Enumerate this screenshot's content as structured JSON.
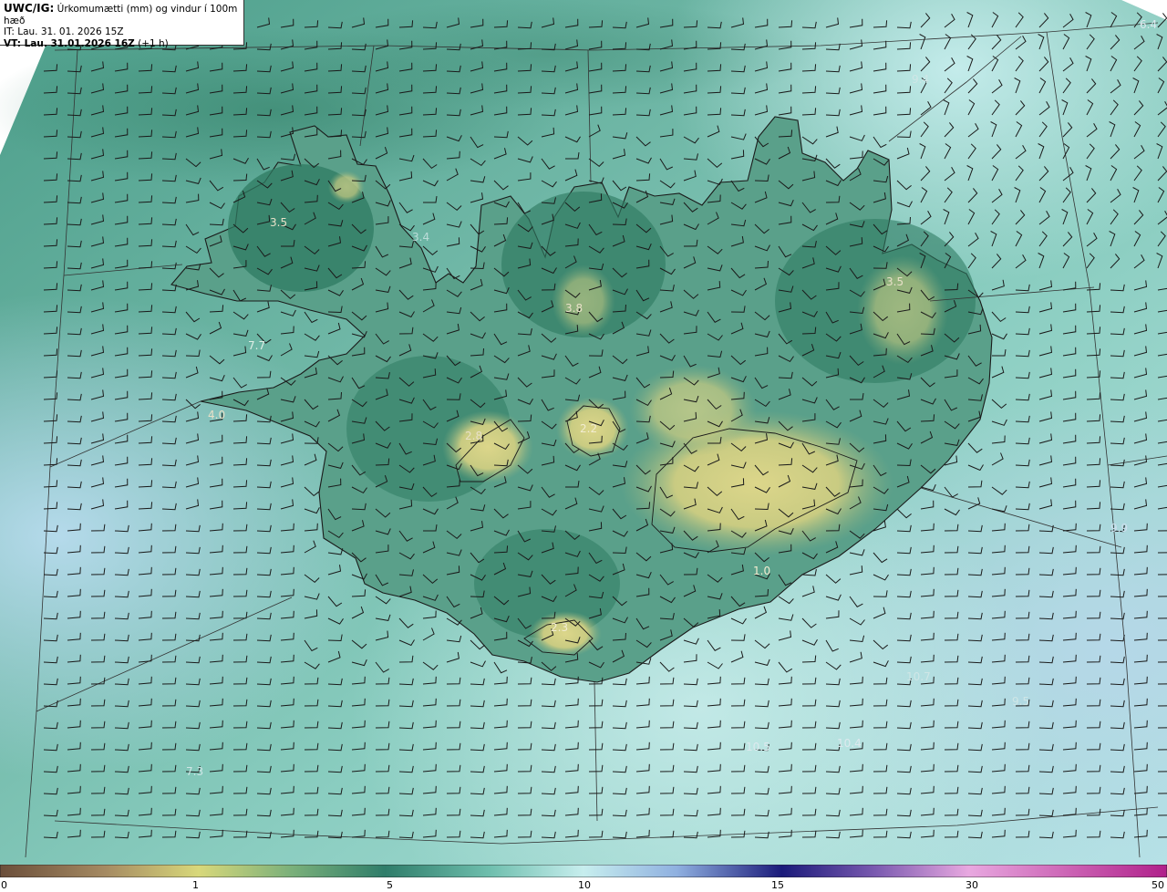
{
  "header": {
    "model": "UWC/IG:",
    "title": "Úrkomumætti (mm) og vindur í 100m hæð",
    "it_line": "IT: Lau. 31. 01. 2026 15Z",
    "vt_prefix": "VT: Lau. 31.01.2026 16Z",
    "vt_suffix": " (+1 h)"
  },
  "map_labels": [
    {
      "text": "3.5"
    },
    {
      "text": "3.4"
    },
    {
      "text": "7.7"
    },
    {
      "text": "4.0"
    },
    {
      "text": "3.8"
    },
    {
      "text": "2.8"
    },
    {
      "text": "2.2"
    },
    {
      "text": "3.5"
    },
    {
      "text": "9.4"
    },
    {
      "text": "6.4"
    },
    {
      "text": "10.7"
    },
    {
      "text": "9.5"
    },
    {
      "text": "10.5"
    },
    {
      "text": "10.4"
    },
    {
      "text": "7.3"
    },
    {
      "text": "1.0"
    },
    {
      "text": "9.9"
    },
    {
      "text": "2.3"
    }
  ],
  "colorbar": {
    "ticks": [
      "0",
      "1",
      "5",
      "10",
      "15",
      "30",
      "50"
    ],
    "colors": {
      "low": "#6b4e3a",
      "yellow": "#d8d87a",
      "green": "#2f7d6a",
      "light": "#c7eeee",
      "navy": "#1a1a7a",
      "magenta": "#b0208a"
    }
  },
  "legend_colors": {
    "land_yellow": "#d5d084",
    "land_green": "#3b8a70",
    "sea_teal": "#7cc0b4",
    "sea_light": "#b8e4e4",
    "coast_line": "#1a1a1a"
  }
}
